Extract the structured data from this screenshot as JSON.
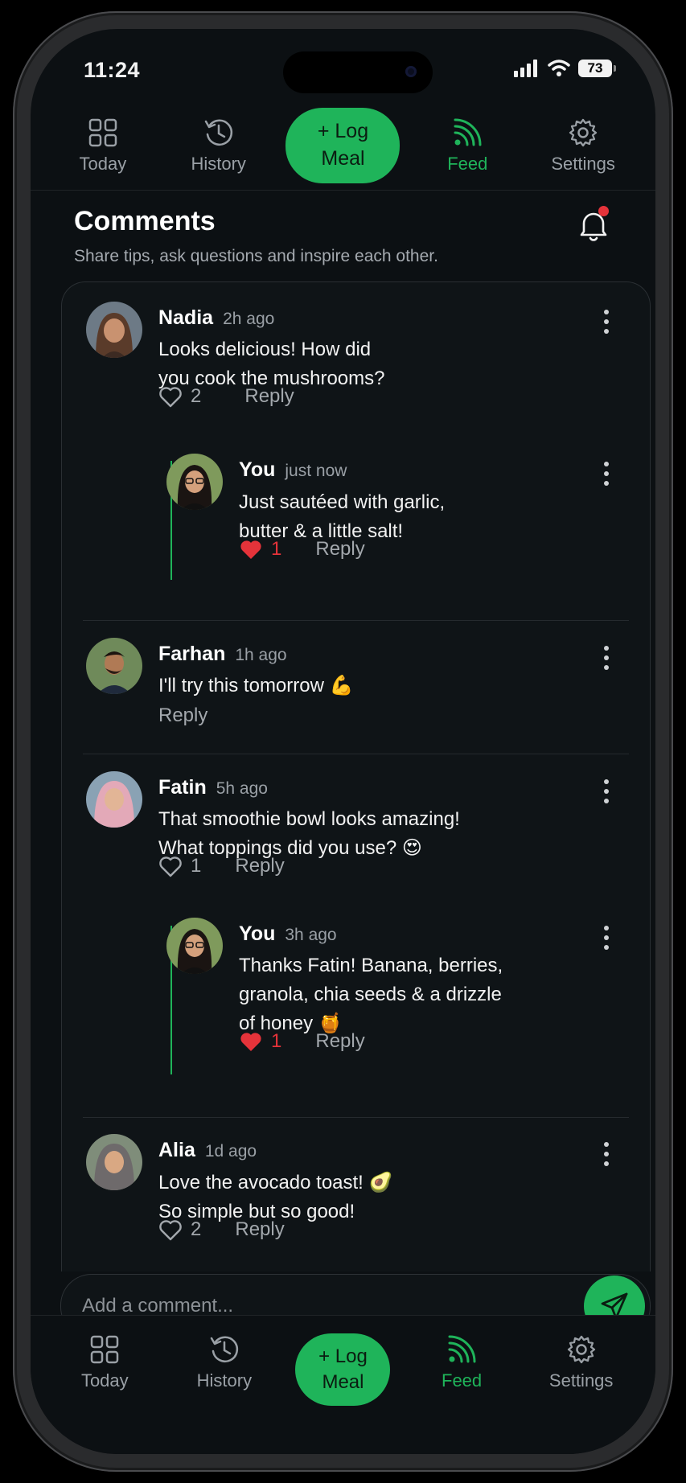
{
  "status": {
    "time": "11:24",
    "battery": "73"
  },
  "nav": {
    "today": "Today",
    "history": "History",
    "log_line1": "+ Log",
    "log_line2": "Meal",
    "feed": "Feed",
    "settings": "Settings"
  },
  "header": {
    "title": "Comments",
    "subtitle": "Share tips, ask questions and inspire each other."
  },
  "comments": [
    {
      "name": "Nadia",
      "time": "2h ago",
      "line1": "Looks delicious! How did",
      "line2": "you cook the mushrooms?",
      "likes": "2",
      "reply": "Reply",
      "replies": [
        {
          "name": "You",
          "time": "just now",
          "line1": "Just sautéed with garlic,",
          "line2": "butter & a little salt!",
          "likes": "1",
          "reply": "Reply"
        }
      ]
    },
    {
      "name": "Farhan",
      "time": "1h ago",
      "line1": "I'll try this tomorrow 💪",
      "reply": "Reply"
    },
    {
      "name": "Fatin",
      "time": "5h ago",
      "line1": "That smoothie bowl looks amazing!",
      "line2": "What toppings did you use? 😍",
      "likes": "1",
      "reply": "Reply",
      "replies": [
        {
          "name": "You",
          "time": "3h ago",
          "line1": "Thanks Fatin! Banana, berries,",
          "line2": "granola, chia seeds & a drizzle",
          "line3": "of honey 🍯",
          "likes": "1",
          "reply": "Reply"
        }
      ]
    },
    {
      "name": "Alia",
      "time": "1d ago",
      "line1": "Love the avocado toast! 🥑",
      "line2": "So simple but so good!",
      "likes": "2",
      "reply": "Reply"
    }
  ],
  "composer": {
    "placeholder": "Add a comment..."
  },
  "colors": {
    "accent": "#1fb45a",
    "like_red": "#e5333a",
    "background": "#0c1013"
  }
}
